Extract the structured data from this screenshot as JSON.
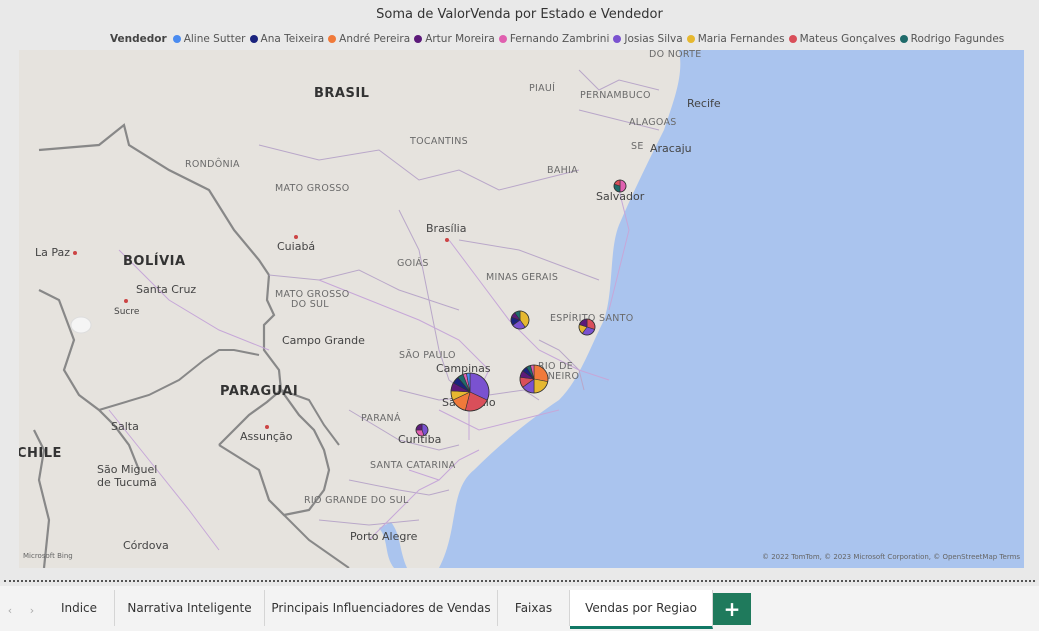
{
  "visual": {
    "title": "Soma de ValorVenda por Estado e Vendedor",
    "legend_title": "Vendedor",
    "legend": [
      {
        "name": "Aline Sutter",
        "color": "#4a8bf0"
      },
      {
        "name": "Ana Teixeira",
        "color": "#1a237e"
      },
      {
        "name": "André Pereira",
        "color": "#f07a3a"
      },
      {
        "name": "Artur Moreira",
        "color": "#5c1a7a"
      },
      {
        "name": "Fernando Zambrini",
        "color": "#e060b0"
      },
      {
        "name": "Josias Silva",
        "color": "#7a52d0"
      },
      {
        "name": "Maria Fernandes",
        "color": "#e6b830"
      },
      {
        "name": "Mateus Gonçalves",
        "color": "#d94f5a"
      },
      {
        "name": "Rodrigo Fagundes",
        "color": "#1f6b6b"
      }
    ]
  },
  "map": {
    "countries": {
      "brasil": "BRASIL",
      "bolivia": "BOLÍVIA",
      "paraguai": "PARAGUAI",
      "chile": "CHILE"
    },
    "states": {
      "rondonia": "RONDÔNIA",
      "mato_grosso": "MATO GROSSO",
      "mato_grosso_sul_1": "MATO GROSSO",
      "mato_grosso_sul_2": "DO SUL",
      "goias": "GOIÁS",
      "minas": "MINAS GERAIS",
      "sao_paulo": "SÃO PAULO",
      "parana": "PARANÁ",
      "santa_catarina": "SANTA CATARINA",
      "rio_grande": "RIO GRANDE DO SUL",
      "tocantins": "TOCANTINS",
      "bahia": "BAHIA",
      "piaui": "PIAUÍ",
      "pernambuco": "PERNAMBUCO",
      "alagoas": "ALAGOAS",
      "se": "SE",
      "espirito_santo": "ESPÍRITO SANTO",
      "rio_1": "RIO DE",
      "rio_2": "JANEIRO",
      "norte": "DO NORTE"
    },
    "cities": {
      "recife": "Recife",
      "aracaju": "Aracaju",
      "salvador": "Salvador",
      "brasilia": "Brasília",
      "cuiaba": "Cuiabá",
      "la_paz": "La Paz",
      "santa_cruz": "Santa Cruz",
      "sucre": "Sucre",
      "campo_grande": "Campo Grande",
      "campinas": "Campinas",
      "sao_paulo": "São Paulo",
      "curitiba": "Curitiba",
      "salta": "Salta",
      "assuncao": "Assunção",
      "tucuma_1": "São Miguel",
      "tucuma_2": "de Tucumã",
      "porto_alegre": "Porto Alegre",
      "cordova": "Córdova"
    },
    "bing_logo": "Microsoft Bing",
    "copyright": "© 2022 TomTom, © 2023 Microsoft Corporation, © OpenStreetMap  Terms",
    "ocean_color": "#aac4ee"
  },
  "pies": [
    {
      "label": "São Paulo",
      "r": 19,
      "slices": [
        {
          "seller": "Josias Silva",
          "value": 32
        },
        {
          "seller": "Mateus Gonçalves",
          "value": 22
        },
        {
          "seller": "André Pereira",
          "value": 14
        },
        {
          "seller": "Maria Fernandes",
          "value": 8
        },
        {
          "seller": "Artur Moreira",
          "value": 7
        },
        {
          "seller": "Ana Teixeira",
          "value": 6
        },
        {
          "seller": "Rodrigo Fagundes",
          "value": 5
        },
        {
          "seller": "Fernando Zambrini",
          "value": 3
        },
        {
          "seller": "Aline Sutter",
          "value": 3
        }
      ]
    },
    {
      "label": "Rio de Janeiro",
      "r": 14,
      "slices": [
        {
          "seller": "André Pereira",
          "value": 28
        },
        {
          "seller": "Maria Fernandes",
          "value": 22
        },
        {
          "seller": "Josias Silva",
          "value": 15
        },
        {
          "seller": "Mateus Gonçalves",
          "value": 12
        },
        {
          "seller": "Artur Moreira",
          "value": 8
        },
        {
          "seller": "Ana Teixeira",
          "value": 6
        },
        {
          "seller": "Rodrigo Fagundes",
          "value": 5
        },
        {
          "seller": "Fernando Zambrini",
          "value": 4
        }
      ]
    },
    {
      "label": "Minas Gerais",
      "r": 9,
      "slices": [
        {
          "seller": "Maria Fernandes",
          "value": 40
        },
        {
          "seller": "Josias Silva",
          "value": 25
        },
        {
          "seller": "Ana Teixeira",
          "value": 15
        },
        {
          "seller": "Artur Moreira",
          "value": 10
        },
        {
          "seller": "Rodrigo Fagundes",
          "value": 10
        }
      ]
    },
    {
      "label": "Espírito Santo",
      "r": 8,
      "slices": [
        {
          "seller": "Mateus Gonçalves",
          "value": 30
        },
        {
          "seller": "Josias Silva",
          "value": 30
        },
        {
          "seller": "Maria Fernandes",
          "value": 20
        },
        {
          "seller": "Artur Moreira",
          "value": 20
        }
      ]
    },
    {
      "label": "Bahia",
      "r": 6,
      "slices": [
        {
          "seller": "Fernando Zambrini",
          "value": 50
        },
        {
          "seller": "Rodrigo Fagundes",
          "value": 30
        },
        {
          "seller": "Mateus Gonçalves",
          "value": 20
        }
      ]
    },
    {
      "label": "Paraná",
      "r": 6,
      "slices": [
        {
          "seller": "Josias Silva",
          "value": 45
        },
        {
          "seller": "Fernando Zambrini",
          "value": 30
        },
        {
          "seller": "Artur Moreira",
          "value": 25
        }
      ]
    }
  ],
  "tabs": {
    "items": [
      {
        "label": "Indice"
      },
      {
        "label": "Narrativa Inteligente"
      },
      {
        "label": "Principais Influenciadores de Vendas"
      },
      {
        "label": "Faixas"
      },
      {
        "label": "Vendas por Regiao"
      }
    ],
    "active": "Vendas por Regiao",
    "add_label": "+",
    "prev_glyph": "‹",
    "next_glyph": "›"
  }
}
